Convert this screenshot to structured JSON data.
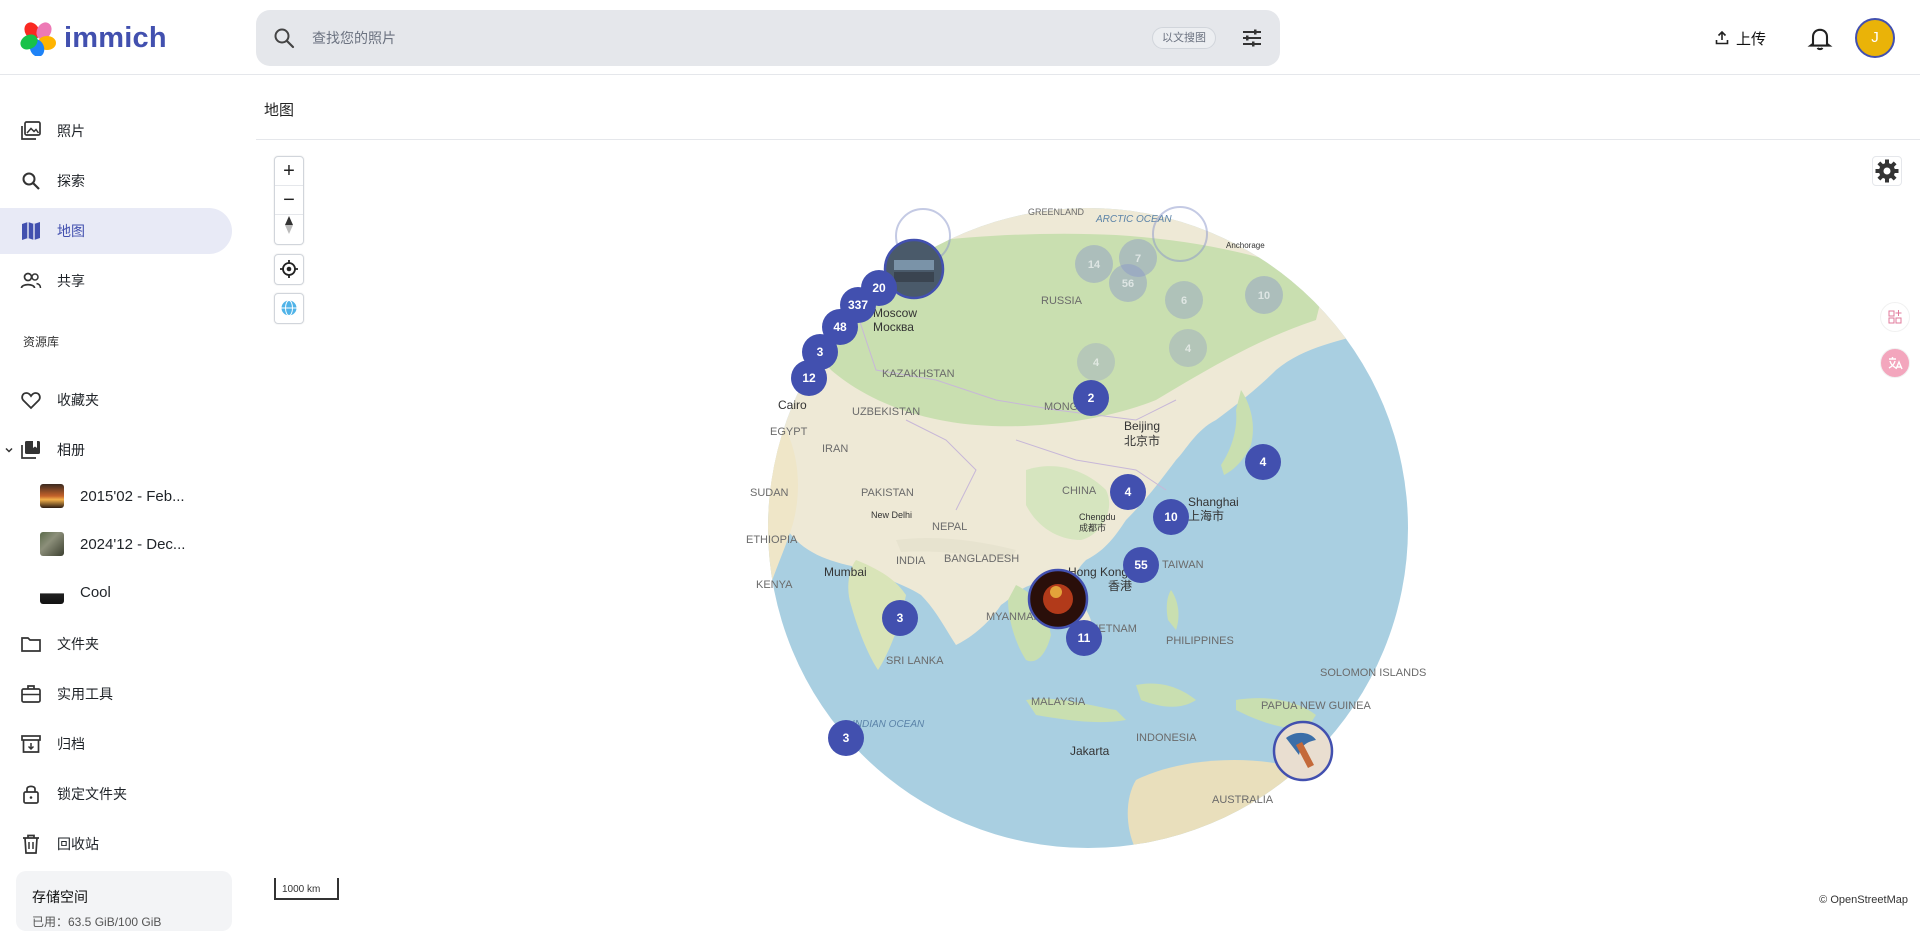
{
  "app": {
    "name": "immich"
  },
  "search": {
    "placeholder": "查找您的照片",
    "context_chip": "以文搜图"
  },
  "header": {
    "upload_label": "上传",
    "avatar_initial": "J"
  },
  "sidebar": {
    "items": [
      {
        "label": "照片",
        "icon": "photos-icon"
      },
      {
        "label": "探索",
        "icon": "search-icon"
      },
      {
        "label": "地图",
        "icon": "map-icon",
        "active": true
      },
      {
        "label": "共享",
        "icon": "people-icon"
      }
    ],
    "library_heading": "资源库",
    "library_items": [
      {
        "label": "收藏夹",
        "icon": "heart-icon"
      },
      {
        "label": "相册",
        "icon": "album-icon"
      }
    ],
    "albums": [
      {
        "label": "2015'02 - Feb..."
      },
      {
        "label": "2024'12 - Dec..."
      },
      {
        "label": "Cool"
      }
    ],
    "bottom_items": [
      {
        "label": "文件夹",
        "icon": "folder-icon"
      },
      {
        "label": "实用工具",
        "icon": "toolbox-icon"
      },
      {
        "label": "归档",
        "icon": "archive-icon"
      },
      {
        "label": "锁定文件夹",
        "icon": "lock-icon"
      },
      {
        "label": "回收站",
        "icon": "trash-icon"
      }
    ],
    "storage_title": "存储空间",
    "storage_usage": "已用：63.5 GiB/100 GiB"
  },
  "page": {
    "title": "地图"
  },
  "map": {
    "scale_label": "1000 km",
    "attribution": "© OpenStreetMap",
    "labels": [
      "GREENLAND",
      "ARCTIC OCEAN",
      "Anchorage",
      "RUSSIA",
      "Moscow",
      "Москва",
      "KAZAKHSTAN",
      "Cairo",
      "EGYPT",
      "UZBEKISTAN",
      "MONGOLIA",
      "Beijing",
      "北京市",
      "IRAN",
      "SUDAN",
      "PAKISTAN",
      "CHINA",
      "Shanghai",
      "上海市",
      "New Delhi",
      "NEPAL",
      "Chengdu",
      "成都市",
      "ETHIOPIA",
      "INDIA",
      "BANGLADESH",
      "Hong Kong",
      "香港",
      "TAIWAN",
      "Mumbai",
      "KENYA",
      "MYANMAR",
      "VIETNAM",
      "PHILIPPINES",
      "SRI LANKA",
      "SOLOMON ISLANDS",
      "MALAYSIA",
      "PAPUA NEW GUINEA",
      "INDIAN OCEAN",
      "INDONESIA",
      "Jakarta",
      "AUSTRALIA"
    ],
    "clusters": [
      {
        "count": "20"
      },
      {
        "count": "337"
      },
      {
        "count": "48"
      },
      {
        "count": "3"
      },
      {
        "count": "12"
      },
      {
        "count": "2"
      },
      {
        "count": "4"
      },
      {
        "count": "4"
      },
      {
        "count": "10"
      },
      {
        "count": "55"
      },
      {
        "count": "3"
      },
      {
        "count": "11"
      },
      {
        "count": "3"
      }
    ],
    "faded_clusters": [
      {
        "count": "14"
      },
      {
        "count": "7"
      },
      {
        "count": "56"
      },
      {
        "count": "6"
      },
      {
        "count": "4"
      },
      {
        "count": "10"
      },
      {
        "count": "4"
      }
    ]
  }
}
